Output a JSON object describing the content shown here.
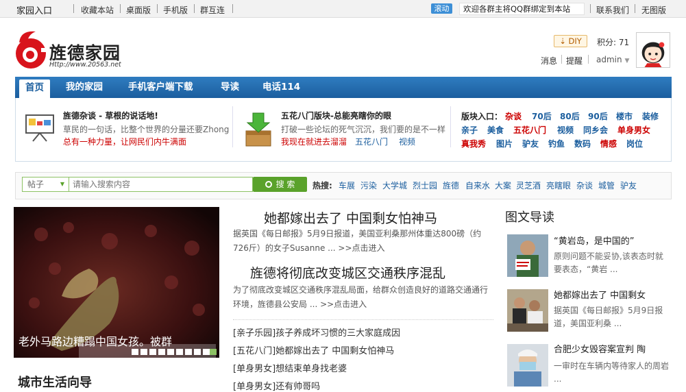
{
  "topbar": {
    "home_label": "家园入口",
    "links": [
      "收藏本站",
      "桌面版",
      "手机版",
      "群互连"
    ],
    "scroll_badge": "滚动",
    "notice": "欢迎各群主将QQ群绑定到本站",
    "right_links": [
      "联系我们",
      "无图版"
    ]
  },
  "header": {
    "logo_text": "旌德家园",
    "logo_url": "Http://www.20563.net",
    "diy_label": "DIY",
    "points": "积分: 71",
    "user_links": [
      "消息",
      "提醒"
    ],
    "username": "admin"
  },
  "nav": {
    "items": [
      "首页",
      "我的家园",
      "手机客户端下载",
      "导读",
      "电话114"
    ]
  },
  "panel": {
    "col1": {
      "title": "旌德杂谈 - 草根的说话地!",
      "line1": "草民的一句话，比整个世界的分量还要Zhong",
      "line2": "总有一种力量，让网民们内牛满面"
    },
    "col2": {
      "title": "五花八门版块-总能亮瞎你的眼",
      "line1": "打破一些论坛的死气沉沉，我们要的是不一样",
      "line2_a": "我现在就进去溜溜",
      "line2_b": "五花八门",
      "line2_c": "视频"
    },
    "col3": {
      "label": "版块入口：",
      "row1": [
        "杂谈",
        "70后",
        "80后",
        "90后",
        "楼市",
        "装修"
      ],
      "row2": [
        "亲子",
        "美食",
        "五花八门",
        "视频",
        "同乡会",
        "单身男女"
      ],
      "row3": [
        "真我秀",
        "图片",
        "驴友",
        "钓鱼",
        "数码",
        "情感",
        "岗位"
      ]
    }
  },
  "search": {
    "type": "帖子",
    "placeholder": "请输入搜索内容",
    "button": "搜 索",
    "hot_label": "热搜:",
    "hot_terms": [
      "车展",
      "污染",
      "大学城",
      "烈士园",
      "旌德",
      "自来水",
      "大案",
      "灵芝酒",
      "亮瞎眼",
      "杂谈",
      "城管",
      "驴友"
    ]
  },
  "slideshow": {
    "caption": "老外马路边糟蹋中国女孩。被群"
  },
  "city_heading": "城市生活向导",
  "headlines": [
    {
      "title": "她都嫁出去了 中国剩女怕神马",
      "summary": "据英国《每日邮报》5月9日报道，美国亚利桑那州体重达800磅（约726斤）的女子Susanne ... >>点击进入"
    },
    {
      "title": "旌德将彻底改变城区交通秩序混乱",
      "summary": "为了彻底改变城区交通秩序混乱局面，给群众创造良好的道路交通通行环境，旌德县公安局 ... >>点击进入"
    }
  ],
  "news_list": [
    "[亲子乐园]孩子养成坏习惯的三大家庭成因",
    "[五花八门]她都嫁出去了 中国剩女怕神马",
    "[单身男女]想结束单身找老婆",
    "[单身男女]还有帅哥吗"
  ],
  "pic_guide": {
    "heading": "图文导读",
    "items": [
      {
        "title": "“黄岩岛，是中国的”",
        "desc": "原则问题不能妥协,该表态时就要表态，“黄岩 ..."
      },
      {
        "title": "她都嫁出去了 中国剩女",
        "desc": "据英国《每日邮报》5月9日报道，美国亚利桑 ..."
      },
      {
        "title": "合肥少女毁容案宣判 陶",
        "desc": "一审时在车辆内等待家人的周岩 ..."
      }
    ]
  },
  "colors": {
    "nav": "#1b5e9e",
    "red": "#cc0000",
    "green": "#5aa22b"
  }
}
